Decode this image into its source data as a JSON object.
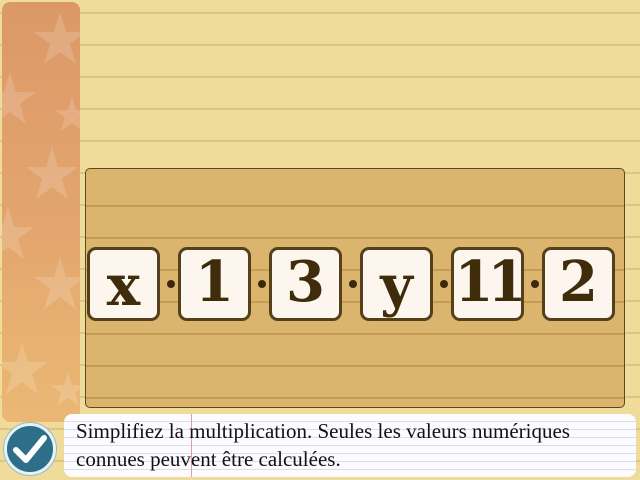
{
  "puzzle": {
    "tiles": [
      {
        "value": "x"
      },
      {
        "value": "1"
      },
      {
        "value": "3"
      },
      {
        "value": "y"
      },
      {
        "value": "11"
      },
      {
        "value": "2"
      }
    ],
    "operator_icon": "multiply-dot-icon"
  },
  "instruction": {
    "text": "Simplifiez la multiplication. Seules les valeurs numériques connues peuvent être calculées."
  },
  "controls": {
    "check_icon": "checkmark-icon"
  },
  "colors": {
    "paper": "#f0dc9a",
    "board": "#dbb46e",
    "tile_fill": "#fdf6ee",
    "tile_border": "#54401a",
    "check_button": "#2d6e88",
    "side_strip": "#e3a66e"
  }
}
